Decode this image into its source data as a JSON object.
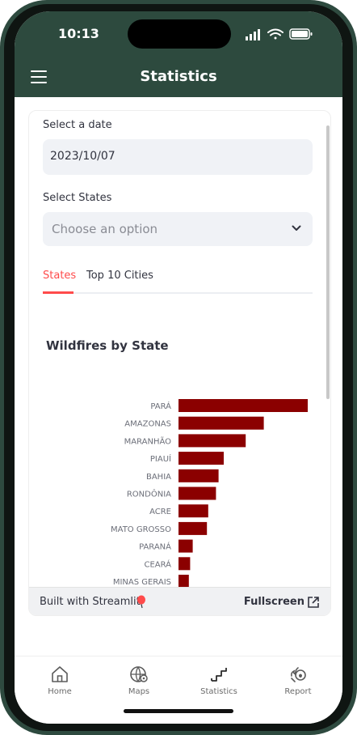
{
  "status_bar": {
    "time": "10:13"
  },
  "header": {
    "title": "Statistics"
  },
  "form": {
    "date_label": "Select a date",
    "date_value": "2023/10/07",
    "states_label": "Select States",
    "states_placeholder": "Choose an option"
  },
  "tabs": [
    {
      "label": "States",
      "active": true
    },
    {
      "label": "Top 10 Cities",
      "active": false
    }
  ],
  "chart_title": "Wildfires by State",
  "chart_data": {
    "type": "bar",
    "orientation": "horizontal",
    "title": "Wildfires by State",
    "categories": [
      "PARÁ",
      "AMAZONAS",
      "MARANHÃO",
      "PIAUÍ",
      "BAHIA",
      "RONDÔNIA",
      "ACRE",
      "MATO GROSSO",
      "PARANÁ",
      "CEARÁ",
      "MINAS GERAIS"
    ],
    "values": [
      100,
      66,
      52,
      35,
      31,
      29,
      23,
      22,
      11,
      9,
      8
    ],
    "bar_color": "#8b0000",
    "grid": false
  },
  "footer": {
    "built_with": "Built with Streamlit",
    "fullscreen": "Fullscreen"
  },
  "tabbar": [
    {
      "label": "Home",
      "icon": "home-icon"
    },
    {
      "label": "Maps",
      "icon": "globe-icon"
    },
    {
      "label": "Statistics",
      "icon": "stairs-chart-icon"
    },
    {
      "label": "Report",
      "icon": "fire-report-icon"
    }
  ],
  "colors": {
    "brand": "#2d4a3e",
    "accent": "#ff4b4b",
    "bar": "#8b0000"
  }
}
